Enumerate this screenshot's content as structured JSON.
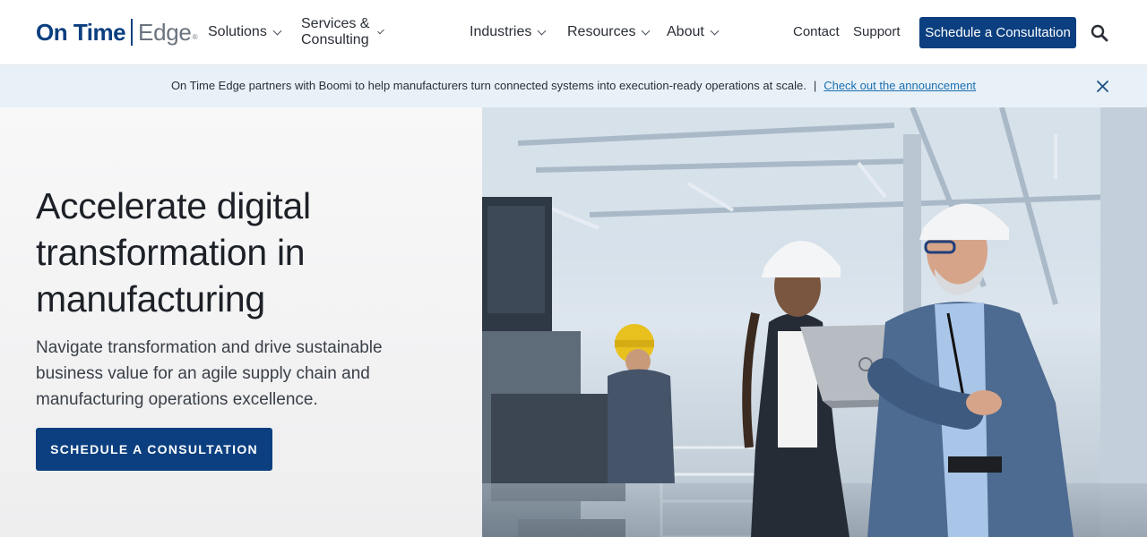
{
  "header": {
    "logo": {
      "part1": "On Time",
      "part2": "Edge",
      "mark": "®"
    },
    "nav": [
      {
        "label": "Solutions"
      },
      {
        "label": "Services & Consulting"
      },
      {
        "label": "Industries"
      },
      {
        "label": "Resources"
      },
      {
        "label": "About"
      }
    ],
    "utility": {
      "contact": "Contact",
      "support": "Support"
    },
    "cta_label": "Schedule a Consultation",
    "search_icon": "search-icon"
  },
  "announcement": {
    "text": "On Time Edge partners with Boomi to help manufacturers turn connected systems into execution-ready operations at scale.",
    "separator": "|",
    "link_text": "Check out the announcement",
    "close_icon": "close-icon"
  },
  "hero": {
    "title": "Accelerate digital transformation in manufacturing",
    "subtitle": "Navigate transformation and drive sustainable business value for an agile supply chain and manufacturing operations excellence.",
    "cta_label": "SCHEDULE A CONSULTATION",
    "image": "factory-engineers-photo"
  },
  "colors": {
    "brand_navy": "#0b3f7f",
    "announcement_bg": "#e9f1f8",
    "link_blue": "#1a6fb0",
    "logo_gray": "#6b7480"
  }
}
